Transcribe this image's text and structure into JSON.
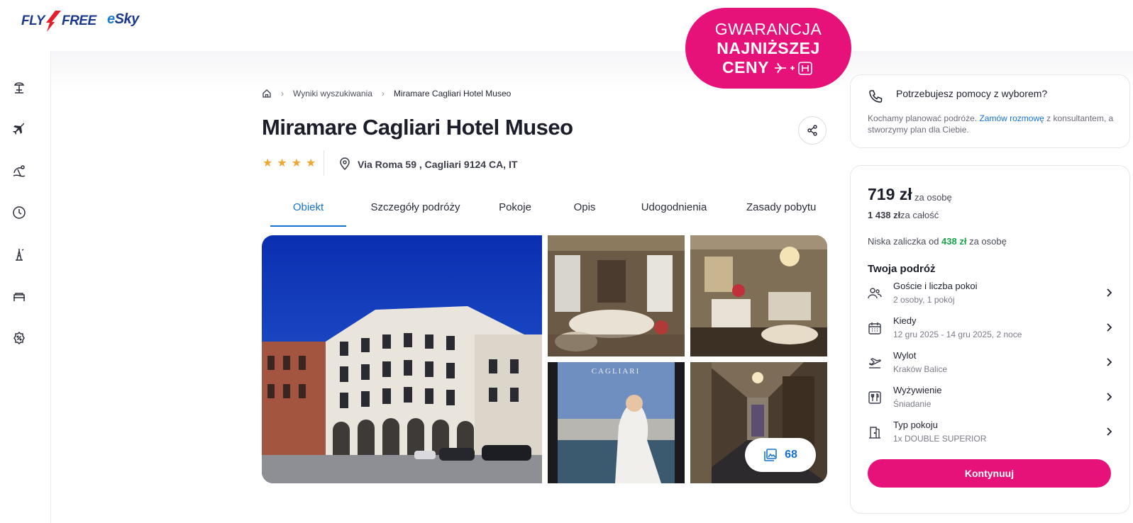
{
  "header": {
    "logo_flyfree_left": "FLY",
    "logo_flyfree_right": "FREE",
    "logo_esky_e": "e",
    "logo_esky_rest": "Sky"
  },
  "sidebar": {
    "items": [
      {
        "icon": "beach-icon"
      },
      {
        "icon": "plane-icon"
      },
      {
        "icon": "holiday-icon"
      },
      {
        "icon": "last-minute-clock-icon"
      },
      {
        "icon": "city-break-icon"
      },
      {
        "icon": "hotel-bed-icon"
      },
      {
        "icon": "discount-icon"
      }
    ]
  },
  "badge": {
    "line1": "GWARANCJA",
    "line2": "NAJNIŻSZEJ",
    "line3": "CENY"
  },
  "breadcrumb": {
    "home_icon": "home-icon",
    "items": [
      "Wyniki wyszukiwania",
      "Miramare Cagliari Hotel Museo"
    ]
  },
  "hotel": {
    "name": "Miramare Cagliari Hotel Museo",
    "stars": 4,
    "address": "Via Roma 59 , Cagliari 9124 CA, IT"
  },
  "tabs": [
    {
      "label": "Obiekt",
      "active": true
    },
    {
      "label": "Szczegóły podróży",
      "active": false
    },
    {
      "label": "Pokoje",
      "active": false
    },
    {
      "label": "Opis",
      "active": false
    },
    {
      "label": "Udogodnienia",
      "active": false
    },
    {
      "label": "Zasady pobytu",
      "active": false
    }
  ],
  "gallery": {
    "photo_count": "68"
  },
  "help": {
    "title": "Potrzebujesz pomocy z wyborem?",
    "text_before": "Kochamy planować podróże. ",
    "link": "Zamów rozmowę",
    "text_after": " z konsultantem, a stworzymy plan dla Ciebie."
  },
  "price": {
    "per_person_amount": "719 zł",
    "per_person_unit": "za osobę",
    "total_amount": "1 438 zł",
    "total_unit": "za całość",
    "deposit_prefix": "Niska zaliczka od ",
    "deposit_amount": "438 zł",
    "deposit_suffix": " za osobę"
  },
  "trip": {
    "title": "Twoja podróż",
    "rows": [
      {
        "label": "Goście i liczba pokoi",
        "value": "2 osoby, 1 pokój",
        "icon": "guests-icon"
      },
      {
        "label": "Kiedy",
        "value": "12 gru 2025 - 14 gru 2025, 2 noce",
        "icon": "calendar-icon"
      },
      {
        "label": "Wylot",
        "value": "Kraków Balice",
        "icon": "departure-icon"
      },
      {
        "label": "Wyżywienie",
        "value": "Śniadanie",
        "icon": "meal-icon"
      },
      {
        "label": "Typ pokoju",
        "value": "1x DOUBLE SUPERIOR",
        "icon": "room-door-icon"
      }
    ],
    "continue_label": "Kontynuuj"
  },
  "colors": {
    "brand_pink": "#e6127a",
    "link_blue": "#1572d3",
    "deposit_green": "#17a34a",
    "star_gold": "#f2a531"
  }
}
